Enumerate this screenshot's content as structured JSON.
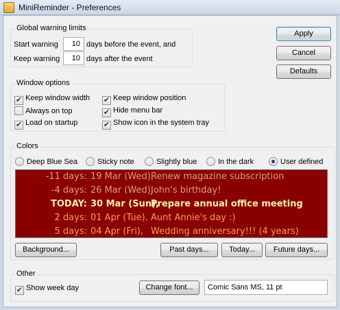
{
  "window": {
    "title": "MiniReminder - Preferences"
  },
  "warning": {
    "title": "Global warning limits",
    "start_label": "Start warning",
    "start_value": "10",
    "start_suffix": "days before the event, and",
    "keep_label": "Keep warning",
    "keep_value": "10",
    "keep_suffix": "days after the event"
  },
  "window_options": {
    "title": "Window options",
    "keep_width": {
      "label": "Keep window width",
      "checked": true
    },
    "always_top": {
      "label": "Always on top",
      "checked": false
    },
    "load_startup": {
      "label": "Load on startup",
      "checked": true
    },
    "keep_position": {
      "label": "Keep window position",
      "checked": true
    },
    "hide_menu": {
      "label": "Hide menu bar",
      "checked": true
    },
    "show_tray": {
      "label": "Show icon in the system tray",
      "checked": true
    }
  },
  "colors": {
    "title": "Colors",
    "schemes": [
      "Deep Blue Sea",
      "Sticky note",
      "Slightly blue",
      "In the dark",
      "User defined"
    ],
    "selected_scheme": "User defined",
    "preview_bg": "#8a0000",
    "past_color": "#d9a07a",
    "today_color": "#fff1a8",
    "future_color": "#f0a050",
    "preview_rows": [
      {
        "days": "-11 days:",
        "date": "19 Mar (Wed),",
        "event": "Renew magazine subscription",
        "kind": "past"
      },
      {
        "days": "-4 days:",
        "date": "26 Mar (Wed),",
        "event": "John's birthday!",
        "kind": "past"
      },
      {
        "days": "TODAY:",
        "date": "30 Mar (Sun),",
        "event": "Prepare annual office meeting",
        "kind": "today"
      },
      {
        "days": "2 days:",
        "date": "01 Apr (Tue),",
        "event": "Aunt Annie's day :)",
        "kind": "future"
      },
      {
        "days": "5 days:",
        "date": "04 Apr (Fri),",
        "event": "Wedding anniversary!!! (4 years)",
        "kind": "future"
      }
    ],
    "background_btn": "Background...",
    "past_btn": "Past days...",
    "today_btn": "Today...",
    "future_btn": "Future days..."
  },
  "other": {
    "title": "Other",
    "show_weekday": {
      "label": "Show week day",
      "checked": true
    },
    "change_font_btn": "Change font...",
    "font_value": "Comic Sans MS, 11 pt"
  },
  "buttons": {
    "apply": "Apply",
    "cancel": "Cancel",
    "defaults": "Defaults"
  }
}
